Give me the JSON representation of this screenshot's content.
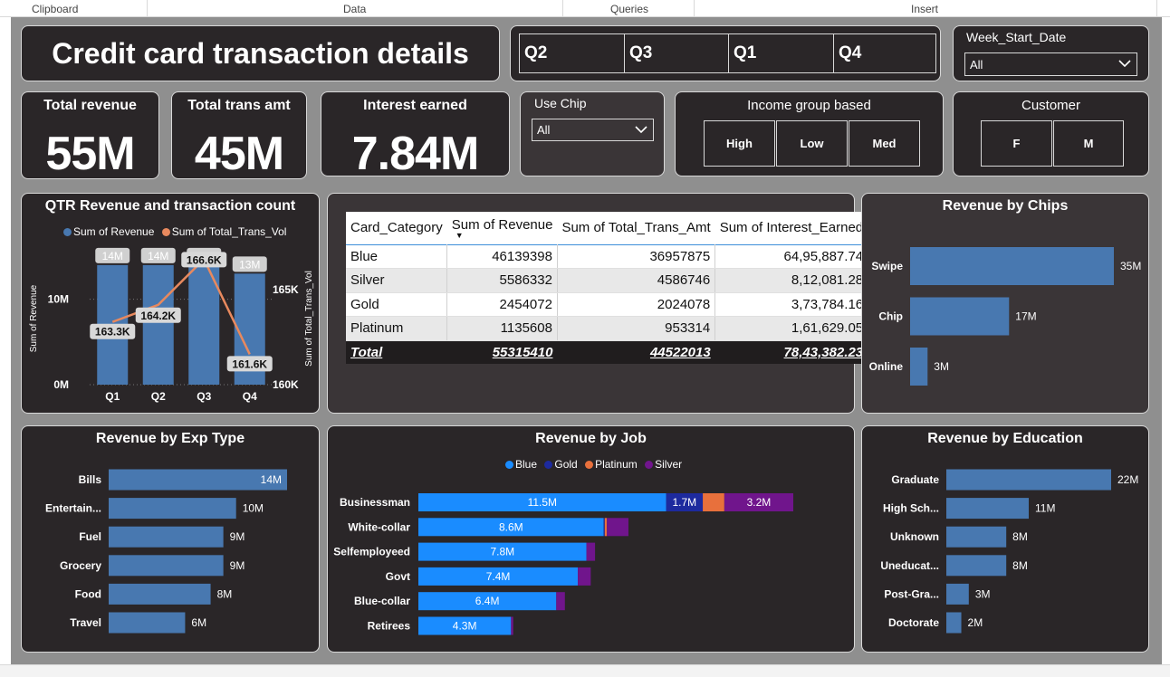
{
  "ribbon": {
    "groups": [
      "Clipboard",
      "Data",
      "Queries",
      "Insert"
    ]
  },
  "header": {
    "title": "Credit card transaction details"
  },
  "quarter_slicer": {
    "items": [
      "Q2",
      "Q3",
      "Q1",
      "Q4"
    ]
  },
  "week_slicer": {
    "title": "Week_Start_Date",
    "value": "All"
  },
  "kpis": [
    {
      "label": "Total revenue",
      "value": "55M"
    },
    {
      "label": "Total trans amt",
      "value": "45M"
    },
    {
      "label": "Interest earned",
      "value": "7.84M"
    }
  ],
  "chip_slicer": {
    "title": "Use Chip",
    "value": "All"
  },
  "income_slicer": {
    "title": "Income group based",
    "items": [
      "High",
      "Low",
      "Med"
    ]
  },
  "customer_slicer": {
    "title": "Customer",
    "items": [
      "F",
      "M"
    ]
  },
  "matrix": {
    "columns": [
      "Card_Category",
      "Sum of Revenue",
      "Sum of Total_Trans_Amt",
      "Sum of Interest_Earned"
    ],
    "rows": [
      [
        "Blue",
        "46139398",
        "36957875",
        "64,95,887.74"
      ],
      [
        "Silver",
        "5586332",
        "4586746",
        "8,12,081.28"
      ],
      [
        "Gold",
        "2454072",
        "2024078",
        "3,73,784.16"
      ],
      [
        "Platinum",
        "1135608",
        "953314",
        "1,61,629.05"
      ]
    ],
    "total": [
      "Total",
      "55315410",
      "44522013",
      "78,43,382.23"
    ]
  },
  "colors": {
    "bar": "#4878b0",
    "line": "#e8895e",
    "blue": "#1a8cff",
    "gold": "#1d2a9e",
    "platinum": "#e8703c",
    "silver": "#70158c",
    "card_bg": "#2a2628"
  },
  "chart_data": [
    {
      "type": "bar+line",
      "title": "QTR Revenue and transaction count",
      "categories": [
        "Q1",
        "Q2",
        "Q3",
        "Q4"
      ],
      "series": [
        {
          "name": "Sum of Revenue",
          "values": [
            14,
            14,
            14,
            13
          ],
          "labels": [
            "14M",
            "14M",
            "14M",
            "13M"
          ],
          "axis": "left"
        },
        {
          "name": "Sum of Total_Trans_Vol",
          "values": [
            163.3,
            164.2,
            166.6,
            161.6
          ],
          "labels": [
            "163.3K",
            "164.2K",
            "166.6K",
            "161.6K"
          ],
          "axis": "right"
        }
      ],
      "ylabel": "Sum of Revenue",
      "y2label": "Sum of Total_Trans_Vol",
      "yticks": [
        "0M",
        "10M"
      ],
      "y2ticks": [
        "160K",
        "165K"
      ],
      "ylim": [
        0,
        16
      ],
      "y2lim": [
        160,
        167
      ]
    },
    {
      "type": "bar",
      "orientation": "horizontal",
      "title": "Revenue by Chips",
      "categories": [
        "Swipe",
        "Chip",
        "Online"
      ],
      "values": [
        35,
        17,
        3
      ],
      "labels": [
        "35M",
        "17M",
        "3M"
      ],
      "xlim": [
        0,
        35
      ]
    },
    {
      "type": "bar",
      "orientation": "horizontal",
      "title": "Revenue by Exp Type",
      "categories": [
        "Bills",
        "Entertain...",
        "Fuel",
        "Grocery",
        "Food",
        "Travel"
      ],
      "values": [
        14,
        10,
        9,
        9,
        8,
        6
      ],
      "labels": [
        "14M",
        "10M",
        "9M",
        "9M",
        "8M",
        "6M"
      ],
      "xlim": [
        0,
        14
      ]
    },
    {
      "type": "bar",
      "orientation": "horizontal",
      "stacked": true,
      "title": "Revenue by Job",
      "categories": [
        "Businessman",
        "White-collar",
        "Selfemployeed",
        "Govt",
        "Blue-collar",
        "Retirees"
      ],
      "series": [
        {
          "name": "Blue",
          "values": [
            11.5,
            8.6,
            7.8,
            7.4,
            6.4,
            4.3
          ],
          "labels": [
            "11.5M",
            "8.6M",
            "7.8M",
            "7.4M",
            "6.4M",
            "4.3M"
          ]
        },
        {
          "name": "Gold",
          "values": [
            1.7,
            0.05,
            0.0,
            0.0,
            0.0,
            0.0
          ],
          "labels": [
            "1.7M",
            "",
            "",
            "",
            "",
            ""
          ]
        },
        {
          "name": "Platinum",
          "values": [
            1.0,
            0.1,
            0.0,
            0.0,
            0.0,
            0.0
          ],
          "labels": [
            "",
            "",
            "",
            "",
            "",
            ""
          ]
        },
        {
          "name": "Silver",
          "values": [
            3.2,
            1.0,
            0.4,
            0.6,
            0.4,
            0.1
          ],
          "labels": [
            "3.2M",
            "",
            "",
            "",
            "",
            ""
          ]
        }
      ],
      "xlim": [
        0,
        17.4
      ]
    },
    {
      "type": "bar",
      "orientation": "horizontal",
      "title": "Revenue by Education",
      "categories": [
        "Graduate",
        "High Sch...",
        "Unknown",
        "Uneducat...",
        "Post-Gra...",
        "Doctorate"
      ],
      "values": [
        22,
        11,
        8,
        8,
        3,
        2
      ],
      "labels": [
        "22M",
        "11M",
        "8M",
        "8M",
        "3M",
        "2M"
      ],
      "xlim": [
        0,
        22
      ]
    }
  ]
}
